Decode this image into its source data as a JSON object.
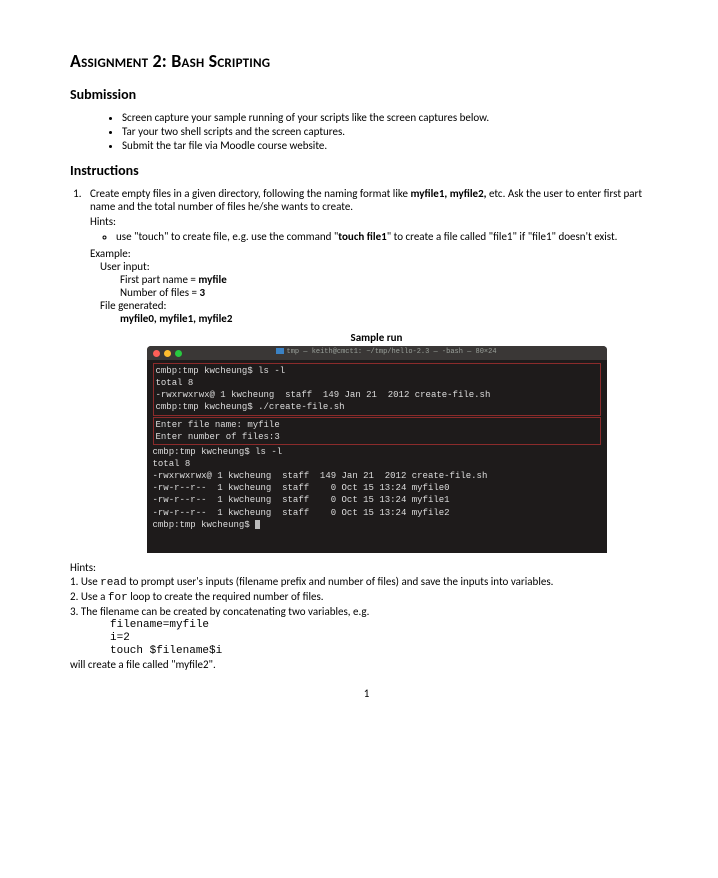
{
  "title": "Assignment 2: Bash Scripting",
  "sections": {
    "submission": {
      "heading": "Submission",
      "items": [
        "Screen capture your sample running of your scripts like the screen captures below.",
        "Tar your two shell scripts and the screen captures.",
        "Submit the tar file via Moodle course website."
      ]
    },
    "instructions": {
      "heading": "Instructions",
      "item1": {
        "text_pre": "Create empty files in a given directory, following the naming format like ",
        "bold1": "myfile1, myfile2,",
        "text_mid": " etc. Ask the user to enter first part name and the total number of files he/she wants to create.",
        "hints_label": "Hints:",
        "hint_pre": "use \"touch\" to create file, e.g. use the command \"",
        "hint_bold": "touch file1",
        "hint_post": "\" to create a file called \"file1\" if \"file1\" doesn't exist."
      },
      "example": {
        "label": "Example:",
        "user_input_label": "User input:",
        "first_part": "First part name = ",
        "first_part_val": "myfile",
        "num_files": "Number of files = ",
        "num_files_val": "3",
        "file_gen_label": "File generated:",
        "file_gen_val": "myfile0, myfile1, myfile2"
      },
      "sample_run_label": "Sample run"
    }
  },
  "terminal": {
    "bar_title": "tmp — keith@cmct1: ~/tmp/hello-2.3 — -bash — 80×24",
    "block1": [
      "cmbp:tmp kwcheung$ ls -l",
      "total 8",
      "-rwxrwxrwx@ 1 kwcheung  staff  149 Jan 21  2012 create-file.sh",
      "cmbp:tmp kwcheung$ ./create-file.sh"
    ],
    "block2": [
      "Enter file name: myfile",
      "Enter number of files:3"
    ],
    "rest": [
      "cmbp:tmp kwcheung$ ls -l",
      "total 8",
      "-rwxrwxrwx@ 1 kwcheung  staff  149 Jan 21  2012 create-file.sh",
      "-rw-r--r--  1 kwcheung  staff    0 Oct 15 13:24 myfile0",
      "-rw-r--r--  1 kwcheung  staff    0 Oct 15 13:24 myfile1",
      "-rw-r--r--  1 kwcheung  staff    0 Oct 15 13:24 myfile2",
      "cmbp:tmp kwcheung$ "
    ]
  },
  "hints2": {
    "label": "Hints:",
    "l1_pre": "1. Use ",
    "l1_code": "read",
    "l1_post": " to prompt user's inputs (filename prefix and number of files) and save the inputs into variables.",
    "l2_pre": "2. Use a ",
    "l2_code": "for",
    "l2_post": " loop to create the required number of files.",
    "l3": "3. The filename can be created by concatenating two variables, e.g.",
    "code1": "filename=myfile",
    "code2": "i=2",
    "code3": "touch $filename$i",
    "l4": "will create a file called \"myfile2\"."
  },
  "page_number": "1"
}
